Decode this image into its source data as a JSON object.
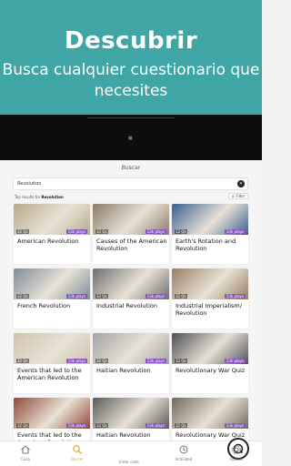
{
  "promo": {
    "title": "Descubrir",
    "subtitle_line1": "Busca cualquier cuestionario que",
    "subtitle_line2": "necesites"
  },
  "header": {
    "title": "Buscar"
  },
  "search": {
    "value": "Revolution",
    "clear_icon": "close-icon"
  },
  "results": {
    "prefix": "Top results for",
    "query": "Revolution"
  },
  "filter": {
    "label": "Filter",
    "icon": "filter-icon"
  },
  "quizzes": [
    {
      "title": "American Revolution",
      "questions": "32 Qs",
      "plays": "13k plays",
      "tone": "#b9a98c"
    },
    {
      "title": "Causes of the American Revolution",
      "questions": "32 Qs",
      "plays": "13k plays",
      "tone": "#8c7d6a"
    },
    {
      "title": "Earth's Rotation and Revolution",
      "questions": "12 Qs",
      "plays": "13k plays",
      "tone": "#3a5f8f"
    },
    {
      "title": "French Revolution",
      "questions": "32 Qs",
      "plays": "13k plays",
      "tone": "#7f8c9a"
    },
    {
      "title": "Industrial Revolution",
      "questions": "32 Qs",
      "plays": "13k plays",
      "tone": "#6e6e6e"
    },
    {
      "title": "Industrial Imperialism/ Revolution",
      "questions": "32 Qs",
      "plays": "13k plays",
      "tone": "#9a7d62"
    },
    {
      "title": "Events that led to the American Revolution",
      "questions": "32 Qs",
      "plays": "13k plays",
      "tone": "#cfc3ad"
    },
    {
      "title": "Haitian Revolution",
      "questions": "32 Qs",
      "plays": "13k plays",
      "tone": "#a3a3a3"
    },
    {
      "title": "Revolutionary War Quiz",
      "questions": "32 Qs",
      "plays": "13k plays",
      "tone": "#4f4f55"
    },
    {
      "title": "Events that led to the American Revolution",
      "questions": "32 Qs",
      "plays": "13k plays",
      "tone": "#8f4a38"
    },
    {
      "title": "Haitian Revolution",
      "questions": "32 Qs",
      "plays": "13k plays",
      "tone": "#5a5a5a"
    },
    {
      "title": "Revolutionary War Quiz",
      "questions": "32 Qs",
      "plays": "13k plays",
      "tone": "#6f6a5c"
    }
  ],
  "tabs": [
    {
      "label": "Casa",
      "icon": "home-icon"
    },
    {
      "label": "Buscar",
      "icon": "search-icon"
    },
    {
      "label": "Enter code",
      "icon": "enter-code-icon"
    },
    {
      "label": "Actividad",
      "icon": "history-icon"
    },
    {
      "label": "Ajustes",
      "icon": "gear-icon"
    }
  ],
  "colors": {
    "teal": "#3fa5a5",
    "active_tab": "#e6a52a",
    "plays_badge": "#8854c0"
  }
}
